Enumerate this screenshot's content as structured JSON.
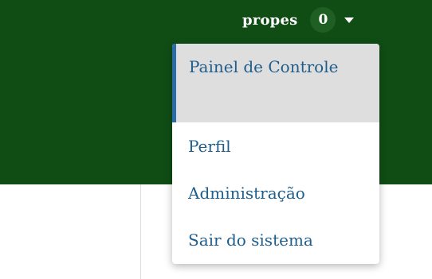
{
  "header": {
    "username": "propes",
    "notification_count": "0",
    "caret_icon": "chevron-down-icon",
    "background_color": "#0f4d15"
  },
  "dropdown": {
    "items": [
      {
        "label": "Painel de Controle",
        "active": true
      },
      {
        "label": "Perfil",
        "active": false
      },
      {
        "label": "Administração",
        "active": false
      },
      {
        "label": "Sair do sistema",
        "active": false
      }
    ],
    "link_color": "#1f5e8c",
    "active_background": "#dedede",
    "active_border_color": "#2a6ca8"
  }
}
